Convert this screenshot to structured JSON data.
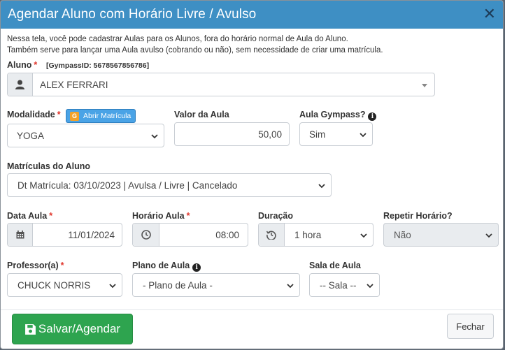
{
  "header": {
    "title": "Agendar Aluno com Horário Livre / Avulso"
  },
  "intro": {
    "line1": "Nessa tela, você pode cadastrar Aulas para os Alunos, fora do horário normal de Aula do Aluno.",
    "line2": "Também serve para lançar uma Aula avulso (cobrando ou não), sem necessidade de criar uma matrícula."
  },
  "aluno": {
    "label": "Aluno",
    "gympass_id": "[GympassID: 5678567856786]",
    "value": "ALEX FERRARI"
  },
  "modalidade": {
    "label": "Modalidade",
    "value": "YOGA",
    "open_button": "Abrir Matrícula",
    "badge": "G"
  },
  "valor": {
    "label": "Valor da Aula",
    "value": "50,00"
  },
  "gympass": {
    "label": "Aula Gympass?",
    "value": "Sim"
  },
  "matriculas": {
    "label": "Matrículas do Aluno",
    "value": "Dt Matrícula: 03/10/2023 | Avulsa / Livre | Cancelado"
  },
  "data_aula": {
    "label": "Data Aula",
    "value": "11/01/2024"
  },
  "horario": {
    "label": "Horário Aula",
    "value": "08:00"
  },
  "duracao": {
    "label": "Duração",
    "value": "1 hora"
  },
  "repetir": {
    "label": "Repetir Horário?",
    "value": "Não"
  },
  "professor": {
    "label": "Professor(a)",
    "value": "CHUCK NORRIS"
  },
  "plano": {
    "label": "Plano de Aula",
    "value": "- Plano de Aula -"
  },
  "sala": {
    "label": "Sala de Aula",
    "value": "-- Sala --"
  },
  "footer": {
    "save": "Salvar/Agendar",
    "close": "Fechar"
  },
  "colors": {
    "header": "#3e8fc4",
    "save": "#2ea44f",
    "required": "#e0352b"
  }
}
